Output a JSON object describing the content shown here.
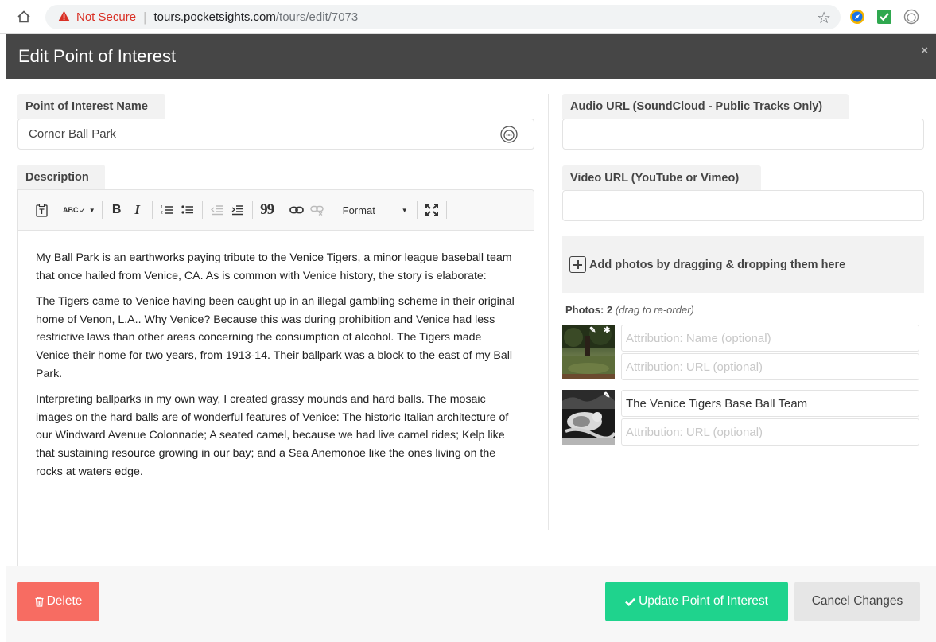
{
  "browser": {
    "not_secure": "Not Secure",
    "url_host": "tours.pocketsights.com",
    "url_path": "/tours/edit/7073",
    "icons": [
      "home-icon",
      "warning-icon",
      "star-icon",
      "compass-extension-icon",
      "checkmark-extension-icon",
      "mask-extension-icon"
    ]
  },
  "modal": {
    "title": "Edit Point of Interest",
    "close_label": "×"
  },
  "form": {
    "name_label": "Point of Interest Name",
    "name_value": "Corner Ball Park",
    "description_label": "Description",
    "toolbar": {
      "spell": "ABC",
      "bold": "B",
      "italic": "I",
      "blockquote": "99",
      "format": "Format"
    },
    "description_paragraphs": [
      "My Ball Park is an earthworks paying tribute to the Venice Tigers, a minor league baseball team that once hailed from Venice, CA.  As is common with Venice history, the story is elaborate:",
      "The Tigers came to Venice having been caught up in an illegal gambling scheme in their original home of Venon, L.A.. Why Venice?  Because this was during prohibition and Venice had less restrictive laws than other areas concerning the consumption of alcohol.  The Tigers made Venice their home for two years, from 1913-14. Their ballpark was a block to the east of my Ball Park.",
      "Interpreting ballparks in my own way, I created grassy mounds and hard balls.  The mosaic images on the hard balls are of wonderful features of Venice:  The historic Italian architecture of our Windward Avenue Colonnade; A seated camel, because we had live camel rides; Kelp like that sustaining resource growing in our bay;  and a Sea Anemonoe like the ones living on the rocks at waters edge."
    ],
    "audio_label": "Audio URL (SoundCloud - Public Tracks Only)",
    "audio_value": "",
    "video_label": "Video URL (YouTube or Vimeo)",
    "video_value": "",
    "dropzone_text": "Add photos by dragging & dropping them here",
    "photos_label": "Photos:",
    "photos_count": "2",
    "photos_hint": "(drag to re-order)",
    "photos": [
      {
        "name_value": "",
        "name_placeholder": "Attribution: Name (optional)",
        "url_value": "",
        "url_placeholder": "Attribution: URL (optional)"
      },
      {
        "name_value": "The Venice Tigers Base Ball Team",
        "name_placeholder": "Attribution: Name (optional)",
        "url_value": "",
        "url_placeholder": "Attribution: URL (optional)"
      }
    ]
  },
  "footer": {
    "delete_label": "Delete",
    "update_label": "Update Point of Interest",
    "cancel_label": "Cancel Changes"
  },
  "colors": {
    "header_bg": "#464646",
    "delete": "#f76c62",
    "update": "#1fd38d",
    "cancel": "#e6e6e6"
  }
}
